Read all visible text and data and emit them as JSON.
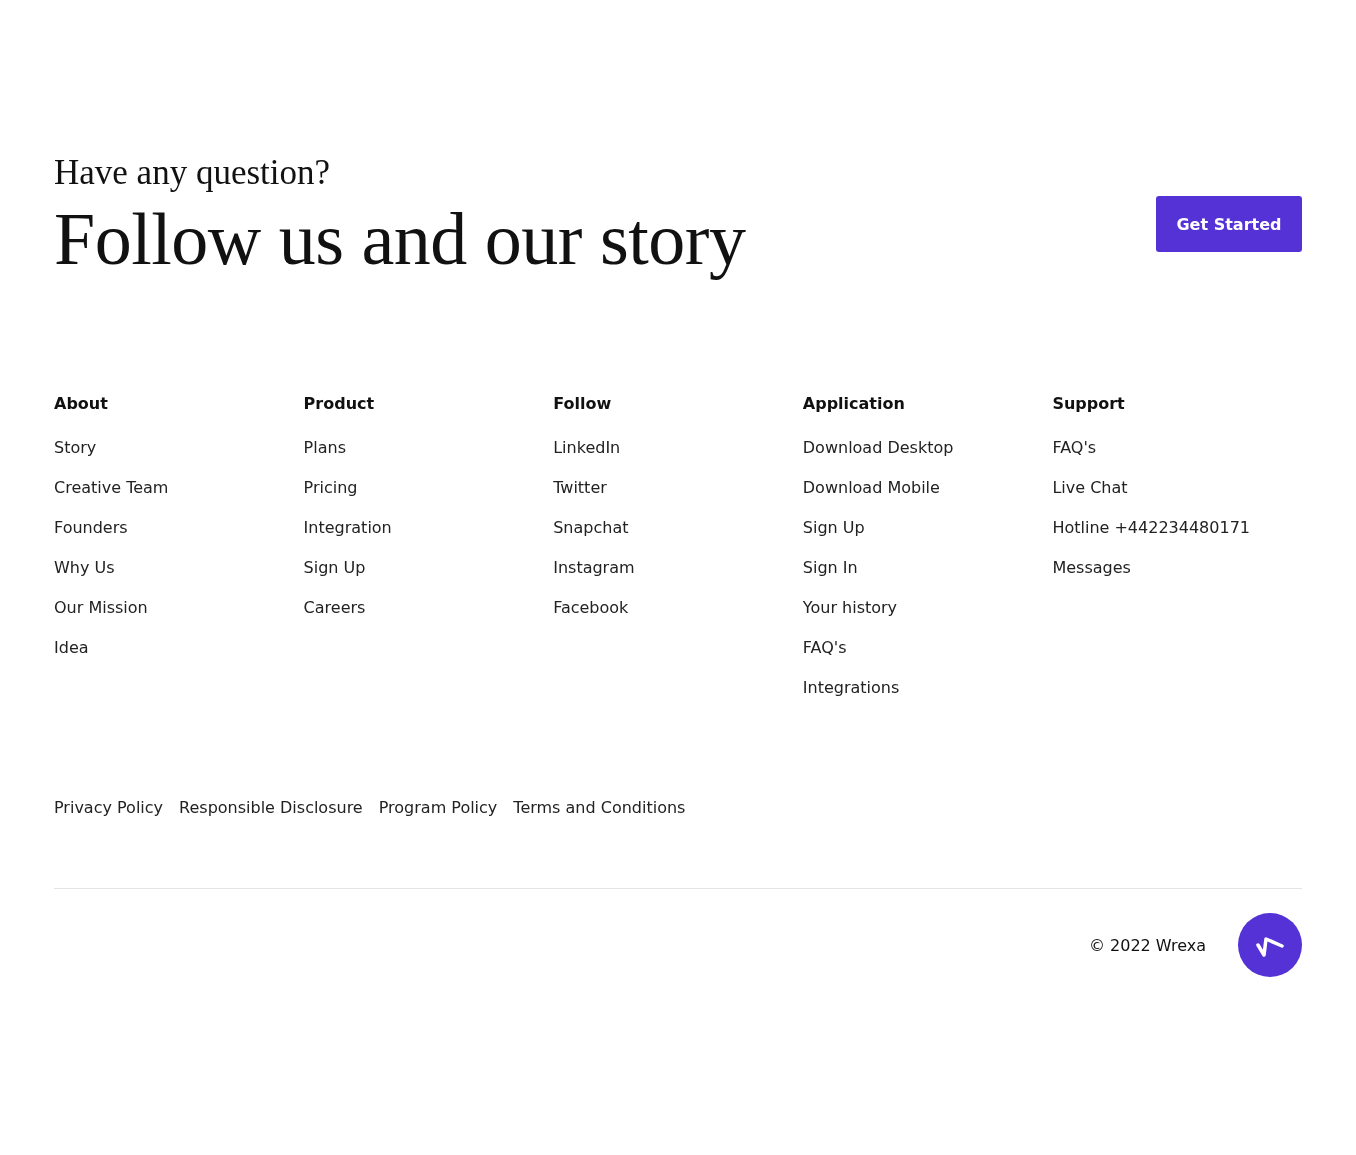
{
  "cta": {
    "eyebrow": "Have any question?",
    "title": "Follow us and our story",
    "button": "Get Started"
  },
  "columns": [
    {
      "heading": "About",
      "links": [
        "Story",
        "Creative Team",
        "Founders",
        "Why Us",
        "Our Mission",
        "Idea"
      ]
    },
    {
      "heading": "Product",
      "links": [
        "Plans",
        "Pricing",
        "Integration",
        "Sign Up",
        "Careers"
      ]
    },
    {
      "heading": "Follow",
      "links": [
        "LinkedIn",
        "Twitter",
        "Snapchat",
        "Instagram",
        "Facebook"
      ]
    },
    {
      "heading": "Application",
      "links": [
        "Download Desktop",
        "Download Mobile",
        "Sign Up",
        "Sign In",
        "Your history",
        "FAQ's",
        "Integrations"
      ]
    },
    {
      "heading": "Support",
      "links": [
        "FAQ's",
        "Live Chat",
        "Hotline +442234480171",
        "Messages"
      ]
    }
  ],
  "legal_links": [
    "Privacy Policy",
    "Responsible Disclosure",
    "Program Policy",
    "Terms and Conditions"
  ],
  "copyright": "© 2022 Wrexa"
}
